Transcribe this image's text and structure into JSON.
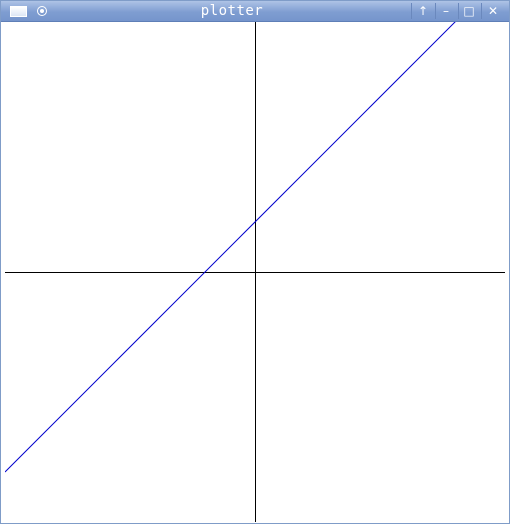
{
  "window": {
    "title": "plotter",
    "controls": [
      "menu-icon",
      "sticky-icon",
      "shade-icon",
      "minimize-icon",
      "maximize-icon",
      "close-icon"
    ]
  },
  "colors": {
    "titlebar": "#7f9dd1",
    "axes": "#000000",
    "curve": "#0000cc"
  },
  "chart_data": {
    "type": "line",
    "title": "",
    "xlabel": "",
    "ylabel": "",
    "xlim": [
      -10,
      10
    ],
    "ylim": [
      -10,
      10
    ],
    "grid": false,
    "legend": "none",
    "axes_through_origin": true,
    "series": [
      {
        "x": [
          -10,
          10
        ],
        "y": [
          -8,
          12
        ]
      }
    ]
  }
}
